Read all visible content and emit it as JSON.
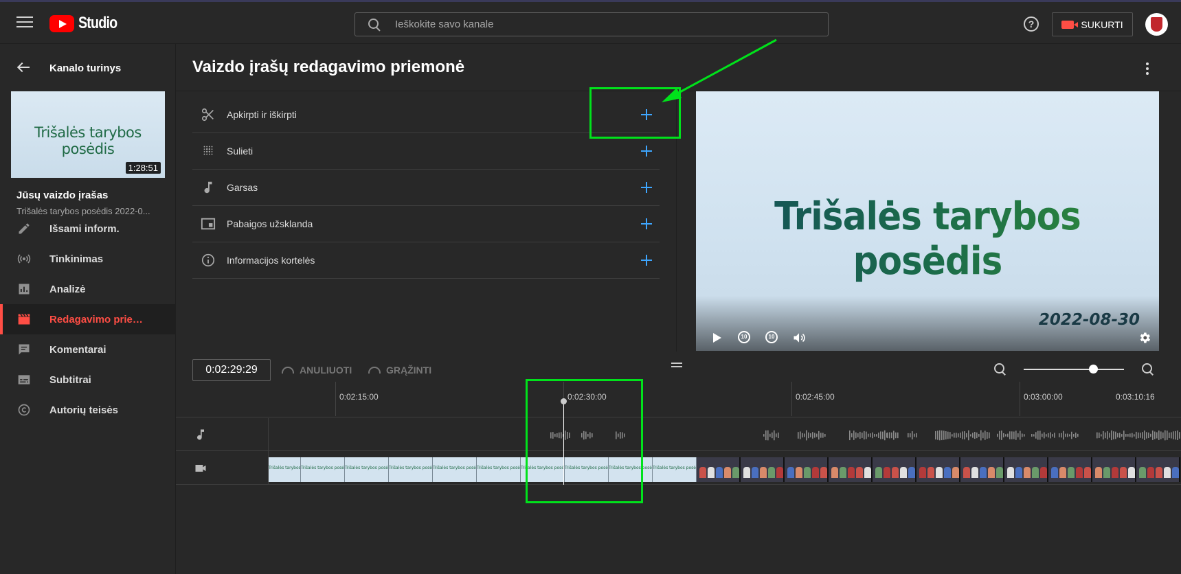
{
  "header": {
    "brand": "Studio",
    "search_placeholder": "Ieškokite savo kanale",
    "help": "?",
    "create_label": "SUKURTI"
  },
  "sidebar": {
    "back_title": "Kanalo turinys",
    "thumbnail_title": "Trišalės tarybos posėdis",
    "thumbnail_duration": "1:28:51",
    "your_video_label": "Jūsų vaizdo įrašas",
    "video_name": "Trišalės tarybos posėdis 2022-0...",
    "items": [
      {
        "label": "Išsami inform.",
        "icon": "pencil-icon"
      },
      {
        "label": "Tinkinimas",
        "icon": "broadcast-icon"
      },
      {
        "label": "Analizė",
        "icon": "analytics-icon"
      },
      {
        "label": "Redagavimo prie…",
        "icon": "clapperboard-icon",
        "active": true
      },
      {
        "label": "Komentarai",
        "icon": "comment-icon"
      },
      {
        "label": "Subtitrai",
        "icon": "subtitles-icon"
      },
      {
        "label": "Autorių teisės",
        "icon": "copyright-icon"
      }
    ]
  },
  "editor": {
    "title": "Vaizdo įrašų redagavimo priemonė",
    "tools": [
      {
        "label": "Apkirpti ir iškirpti",
        "icon": "scissors-icon"
      },
      {
        "label": "Sulieti",
        "icon": "blur-icon"
      },
      {
        "label": "Garsas",
        "icon": "music-note-icon"
      },
      {
        "label": "Pabaigos užsklanda",
        "icon": "end-screen-icon"
      },
      {
        "label": "Informacijos kortelės",
        "icon": "info-icon"
      }
    ],
    "preview_title": "Trišalės tarybos posėdis",
    "preview_date": "2022-08-30",
    "replay_label": "10",
    "forward_label": "10"
  },
  "timeline": {
    "current_time": "0:02:29:29",
    "undo_label": "ANULIUOTI",
    "redo_label": "GRĄŽINTI",
    "zoom_level": 0.7,
    "ticks": [
      "0:02:15:00",
      "0:02:30:00",
      "0:02:45:00",
      "0:03:00:00",
      "0:03:10:16"
    ],
    "frame_text": "Trišalės tarybos posėdis"
  },
  "colors": {
    "accent": "#3ea6ff",
    "active": "#ff4e45",
    "highlight": "#00e21b"
  }
}
